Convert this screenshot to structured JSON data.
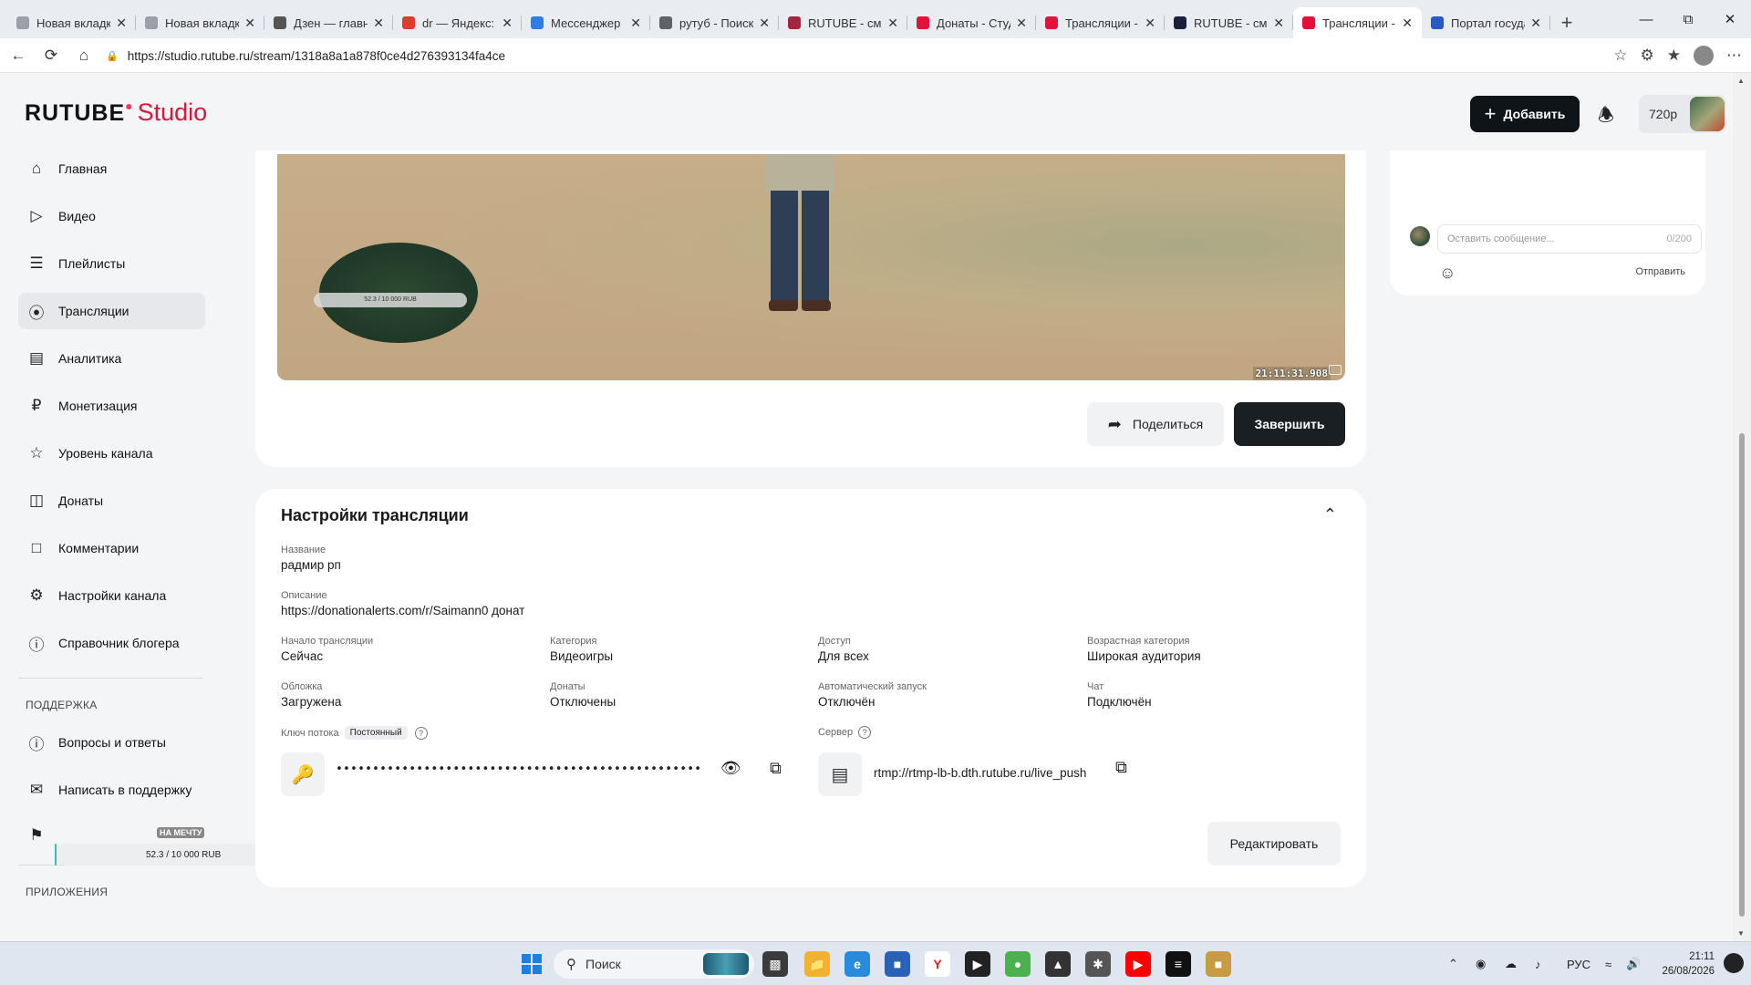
{
  "browser": {
    "tabs": [
      {
        "title": "Новая вкладка",
        "icon": "blank-page-icon",
        "color": "#9aa0a6",
        "active": false
      },
      {
        "title": "Новая вкладка",
        "icon": "blank-page-icon",
        "color": "#9aa0a6",
        "active": false
      },
      {
        "title": "Дзен — главна",
        "icon": "dzen-icon",
        "color": "#555555",
        "active": false
      },
      {
        "title": "dr — Яндекс: н",
        "icon": "yandex-icon",
        "color": "#e03b30",
        "active": false
      },
      {
        "title": "Мессенджер",
        "icon": "messenger-icon",
        "color": "#2f7de1",
        "active": false
      },
      {
        "title": "рутуб - Поиск",
        "icon": "search-icon",
        "color": "#5f6368",
        "active": false
      },
      {
        "title": "RUTUBE - смот",
        "icon": "rutube-icon",
        "color": "#a0283e",
        "active": false
      },
      {
        "title": "Донаты - Студ",
        "icon": "rutube-studio-icon",
        "color": "#e0133a",
        "active": false
      },
      {
        "title": "Трансляции - С",
        "icon": "rutube-studio-icon",
        "color": "#e0133a",
        "active": false
      },
      {
        "title": "RUTUBE - смот",
        "icon": "rutube-icon",
        "color": "#1c1f3a",
        "active": false
      },
      {
        "title": "Трансляции - С",
        "icon": "rutube-studio-icon",
        "color": "#e0133a",
        "active": true
      },
      {
        "title": "Портал госуда",
        "icon": "gosuslugi-icon",
        "color": "#2b59c3",
        "active": false
      }
    ],
    "url": "https://studio.rutube.ru/stream/1318a8a1a878f0ce4d276393134fa4ce"
  },
  "header": {
    "logo_main": "RUTUBE",
    "logo_studio": "Studio",
    "add_button": "Добавить",
    "quality": "720p"
  },
  "sidebar": {
    "items": [
      {
        "label": "Главная",
        "icon": "home-icon"
      },
      {
        "label": "Видео",
        "icon": "video-icon"
      },
      {
        "label": "Плейлисты",
        "icon": "playlist-icon"
      },
      {
        "label": "Трансляции",
        "icon": "broadcast-icon"
      },
      {
        "label": "Аналитика",
        "icon": "analytics-icon"
      },
      {
        "label": "Монетизация",
        "icon": "ruble-icon"
      },
      {
        "label": "Уровень канала",
        "icon": "star-icon"
      },
      {
        "label": "Донаты",
        "icon": "donate-icon"
      },
      {
        "label": "Комментарии",
        "icon": "comment-icon"
      },
      {
        "label": "Настройки канала",
        "icon": "gear-icon"
      },
      {
        "label": "Справочник блогера",
        "icon": "info-icon"
      }
    ],
    "support_head": "ПОДДЕРЖКА",
    "support_items": [
      {
        "label": "Вопросы и ответы",
        "icon": "question-icon"
      },
      {
        "label": "Написать в поддержку",
        "icon": "mail-icon"
      }
    ],
    "apps_head": "ПРИЛОЖЕНИЯ"
  },
  "video": {
    "timestamp": "21:11:31.908",
    "minimap_label": "52.3 / 10 000 RUB",
    "share_button": "Поделиться",
    "end_button": "Завершить"
  },
  "chat": {
    "placeholder": "Оставить сообщение...",
    "counter": "0/200",
    "send": "Отправить"
  },
  "settings": {
    "title": "Настройки трансляции",
    "name_label": "Название",
    "name_value": "радмир рп",
    "desc_label": "Описание",
    "desc_value": "https://donationalerts.com/r/Saimann0 донат",
    "row1": [
      {
        "label": "Начало трансляции",
        "value": "Сейчас"
      },
      {
        "label": "Категория",
        "value": "Видеоигры"
      },
      {
        "label": "Доступ",
        "value": "Для всех"
      },
      {
        "label": "Возрастная категория",
        "value": "Широкая аудитория"
      }
    ],
    "row2": [
      {
        "label": "Обложка",
        "value": "Загружена"
      },
      {
        "label": "Донаты",
        "value": "Отключены"
      },
      {
        "label": "Автоматический запуск",
        "value": "Отключён"
      },
      {
        "label": "Чат",
        "value": "Подключён"
      }
    ],
    "key_label": "Ключ потока",
    "key_badge": "Постоянный",
    "key_masked": "••••••••••••••••••••••••••••••••••••••••••••••••••••••••••••••••",
    "server_label": "Сервер",
    "server_url": "rtmp://rtmp-lb-b.dth.rutube.ru/live_push",
    "edit_button": "Редактировать"
  },
  "overlay": {
    "title": "НА МЕЧТУ",
    "progress_text": "52.3 / 10 000 RUB",
    "progress": 0.00523
  },
  "taskbar": {
    "search": "Поиск",
    "lang": "РУС",
    "time": "21:11",
    "date": "26/08/2026"
  }
}
